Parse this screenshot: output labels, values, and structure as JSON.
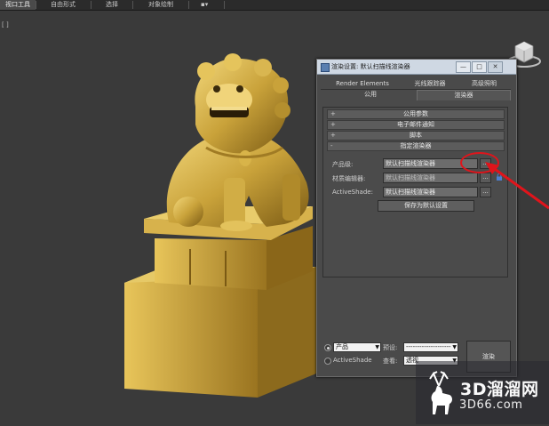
{
  "menubar": {
    "tabs": [
      "视口工具",
      "自由形式",
      "选择",
      "对象绘制",
      "▪▾"
    ]
  },
  "viewport": {
    "label": "[ ]"
  },
  "dialog": {
    "title": "渲染设置: 默认扫描线渲染器",
    "window_buttons": [
      "—",
      "□",
      "✕"
    ],
    "tabs_row1": [
      "Render Elements",
      "光线跟踪器",
      "高级照明"
    ],
    "tabs_row2": [
      "公用",
      "渲染器"
    ],
    "rollouts": [
      {
        "sign": "+",
        "label": "公用参数"
      },
      {
        "sign": "+",
        "label": "电子邮件通知"
      },
      {
        "sign": "+",
        "label": "脚本"
      },
      {
        "sign": "-",
        "label": "指定渲染器"
      }
    ],
    "assign": {
      "production_label": "产品级:",
      "production_value": "默认扫描线渲染器",
      "material_label": "材质编辑器:",
      "material_value": "默认扫描线渲染器",
      "activeshade_label": "ActiveShade:",
      "activeshade_value": "默认扫描线渲染器",
      "dots": "...",
      "save_default": "保存为默认设置"
    },
    "bottom": {
      "production_radio": "产品",
      "activeshade_radio": "ActiveShade",
      "preset_label": "预设:",
      "preset_value": "--------------------",
      "view_label": "查看:",
      "view_value": "透视",
      "render_button": "渲染"
    }
  },
  "watermark": {
    "brand": "3D溜溜网",
    "site": "3D66.com"
  },
  "colors": {
    "accent_red": "#e0141b",
    "gold": "#c9a23a",
    "dialog_bg": "#4a4a4a"
  }
}
